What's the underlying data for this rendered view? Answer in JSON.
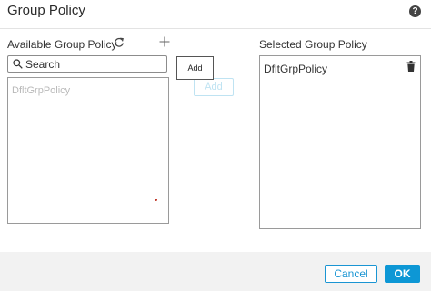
{
  "dialog": {
    "title": "Group Policy",
    "help_icon": "help-icon"
  },
  "available": {
    "label": "Available Group Policy",
    "refresh_icon": "refresh-icon",
    "add_icon": "plus-icon",
    "search_placeholder": "Search",
    "search_value": "",
    "items": [
      "DfltGrpPolicy"
    ]
  },
  "actions": {
    "add_tooltip": "Add",
    "add_button": "Add"
  },
  "selected": {
    "label": "Selected Group Policy",
    "items": [
      "DfltGrpPolicy"
    ],
    "delete_icon": "trash-icon"
  },
  "footer": {
    "cancel_label": "Cancel",
    "ok_label": "OK"
  },
  "colors": {
    "primary": "#0d97d5",
    "primary_light": "#bfe3f2",
    "footer_bg": "#f2f2f2"
  }
}
